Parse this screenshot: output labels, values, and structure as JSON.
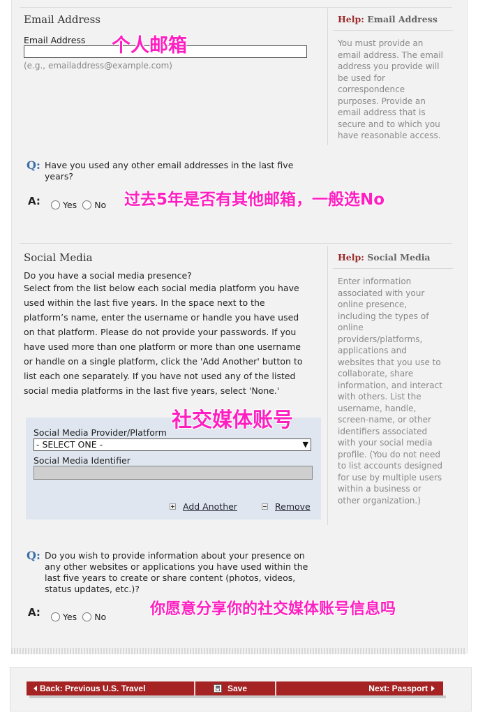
{
  "email_section": {
    "title": "Email Address",
    "field_label": "Email Address",
    "field_value": "",
    "hint": "(e.g., emailaddress@example.com)",
    "help_prefix": "Help:",
    "help_topic": "Email Address",
    "help_lines": [
      "You must provide an",
      "email address. The email",
      "address you provide will",
      "be used for",
      "correspondence",
      "purposes. Provide an",
      "email address that is",
      "secure and to which you",
      "have reasonable access."
    ]
  },
  "other_email_question": {
    "q_letter": "Q:",
    "a_letter": "A:",
    "text_line1": "Have you used any other email addresses in the last five",
    "text_line2": "years?",
    "yes_label": "Yes",
    "no_label": "No"
  },
  "social_section": {
    "title": "Social Media",
    "question": "Do you have a social media presence?",
    "instructions": [
      "Select from the list below each social media platform you have",
      "used within the last five years. In the space next to the",
      "platform’s name, enter the username or handle you have used",
      "on that platform. Please do not provide your passwords. If you",
      "have used more than one platform or more than one username",
      "or handle on a single platform, click the 'Add Another' button to",
      "list each one separately. If you have not used any of the listed",
      "social media platforms in the last five years, select 'None.'"
    ],
    "provider_label": "Social Media Provider/Platform",
    "provider_selected": "- SELECT ONE -",
    "identifier_label": "Social Media Identifier",
    "identifier_value": "",
    "add_another": "Add Another",
    "remove": "Remove",
    "help_prefix": "Help:",
    "help_topic": "Social Media",
    "help_lines": [
      "Enter information",
      "associated with your",
      "online presence,",
      "including the types of",
      "online",
      "providers/platforms,",
      "applications and",
      "websites that you use to",
      "collaborate, share",
      "information, and interact",
      "with others. List the",
      "username, handle,",
      "screen-name, or other",
      "identifiers associated",
      "with your social media",
      "profile. (You do not need",
      "to list accounts designed",
      "for use by multiple users",
      "within a business or",
      "other organization.)"
    ]
  },
  "other_websites_question": {
    "q_letter": "Q:",
    "a_letter": "A:",
    "lines": [
      "Do you wish to provide information about your presence on",
      "any other websites or applications you have used within the",
      "last five years to create or share content (photos, videos,",
      "status updates, etc.)?"
    ],
    "yes_label": "Yes",
    "no_label": "No"
  },
  "annotations": {
    "email": "个人邮箱",
    "other_email": "过去5年是否有其他邮箱，一般选No",
    "social": "社交媒体账号",
    "other_websites": "你愿意分享你的社交媒体账号信息吗"
  },
  "navigation": {
    "back": "Back: Previous U.S. Travel",
    "save": "Save",
    "next": "Next: Passport"
  },
  "colors": {
    "accent_red": "#a52323",
    "question_blue": "#3a6ea8",
    "annotation_pink": "#ff1fc0",
    "panel_bg": "#dfe6ef"
  }
}
